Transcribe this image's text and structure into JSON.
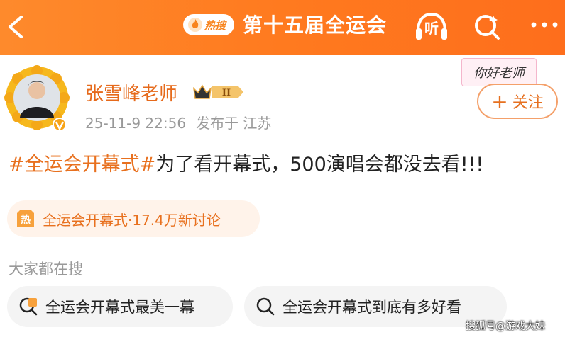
{
  "header": {
    "hot_label": "热搜",
    "title": "第十五届全运会",
    "listen_label": "听",
    "icons": {
      "back": "back-chevron-icon",
      "search": "search-icon",
      "more": "more-dots-icon"
    },
    "background_color": "#ff7d22"
  },
  "post": {
    "username": "张雪峰老师",
    "vip_level": "II",
    "date": "25-11-9 22:56",
    "location": "发布于 江苏",
    "sticker_text": "你好老师",
    "follow_label": "关注",
    "follow_plus": "+",
    "text_tag": "#全运会开幕式#",
    "text_body": "为了看开幕式，500演唱会都没去看!!!",
    "accent_color": "#e8701e"
  },
  "topic_chip": {
    "label": "全运会开幕式·17.4万新讨论",
    "hot_icon_text": "热"
  },
  "trending": {
    "section_label": "大家都在搜",
    "suggestions": [
      {
        "label": "全运会开幕式最美一幕",
        "icon": "hot-search-icon"
      },
      {
        "label": "全运会开幕式到底有多好看",
        "icon": "search-icon"
      }
    ]
  },
  "watermark": "搜狐号@游戏大妹"
}
